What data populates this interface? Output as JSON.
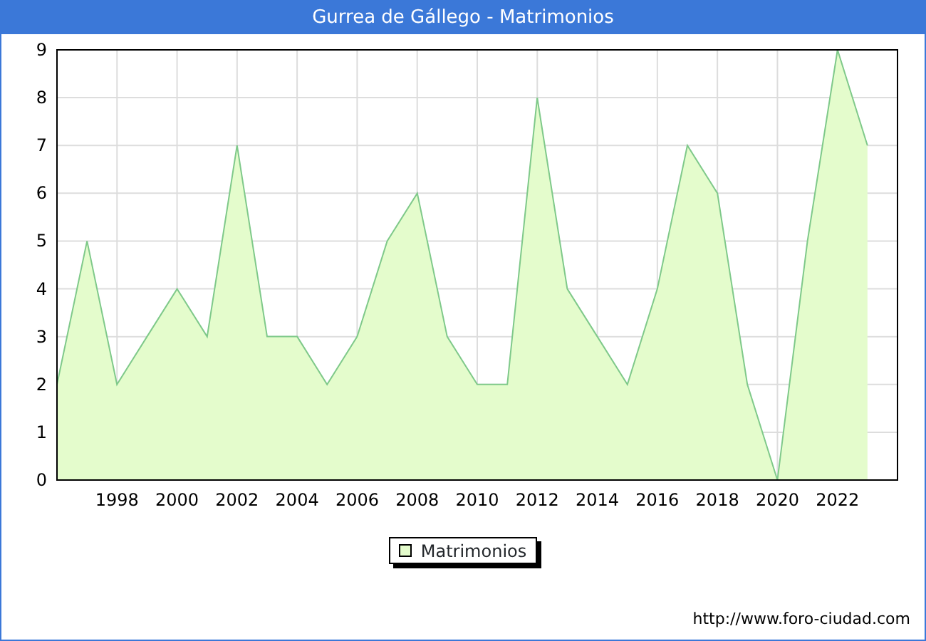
{
  "title": "Gurrea de Gállego - Matrimonios",
  "chart_data": {
    "type": "area",
    "x": [
      1996,
      1997,
      1998,
      1999,
      2000,
      2001,
      2002,
      2003,
      2004,
      2005,
      2006,
      2007,
      2008,
      2009,
      2010,
      2011,
      2012,
      2013,
      2014,
      2015,
      2016,
      2017,
      2018,
      2019,
      2020,
      2021,
      2022,
      2023
    ],
    "series": [
      {
        "name": "Matrimonios",
        "color": "#e4fccc",
        "values": [
          2,
          5,
          2,
          3,
          4,
          3,
          7,
          3,
          3,
          2,
          3,
          5,
          6,
          3,
          2,
          2,
          8,
          4,
          3,
          2,
          4,
          7,
          6,
          2,
          0,
          5,
          9,
          7
        ]
      }
    ],
    "xlim": [
      1996,
      2024
    ],
    "ylim": [
      0,
      9
    ],
    "xticks": [
      1998,
      2000,
      2002,
      2004,
      2006,
      2008,
      2010,
      2012,
      2014,
      2016,
      2018,
      2020,
      2022
    ],
    "yticks": [
      0,
      1,
      2,
      3,
      4,
      5,
      6,
      7,
      8,
      9
    ],
    "grid": true
  },
  "footer_url": "http://www.foro-ciudad.com"
}
